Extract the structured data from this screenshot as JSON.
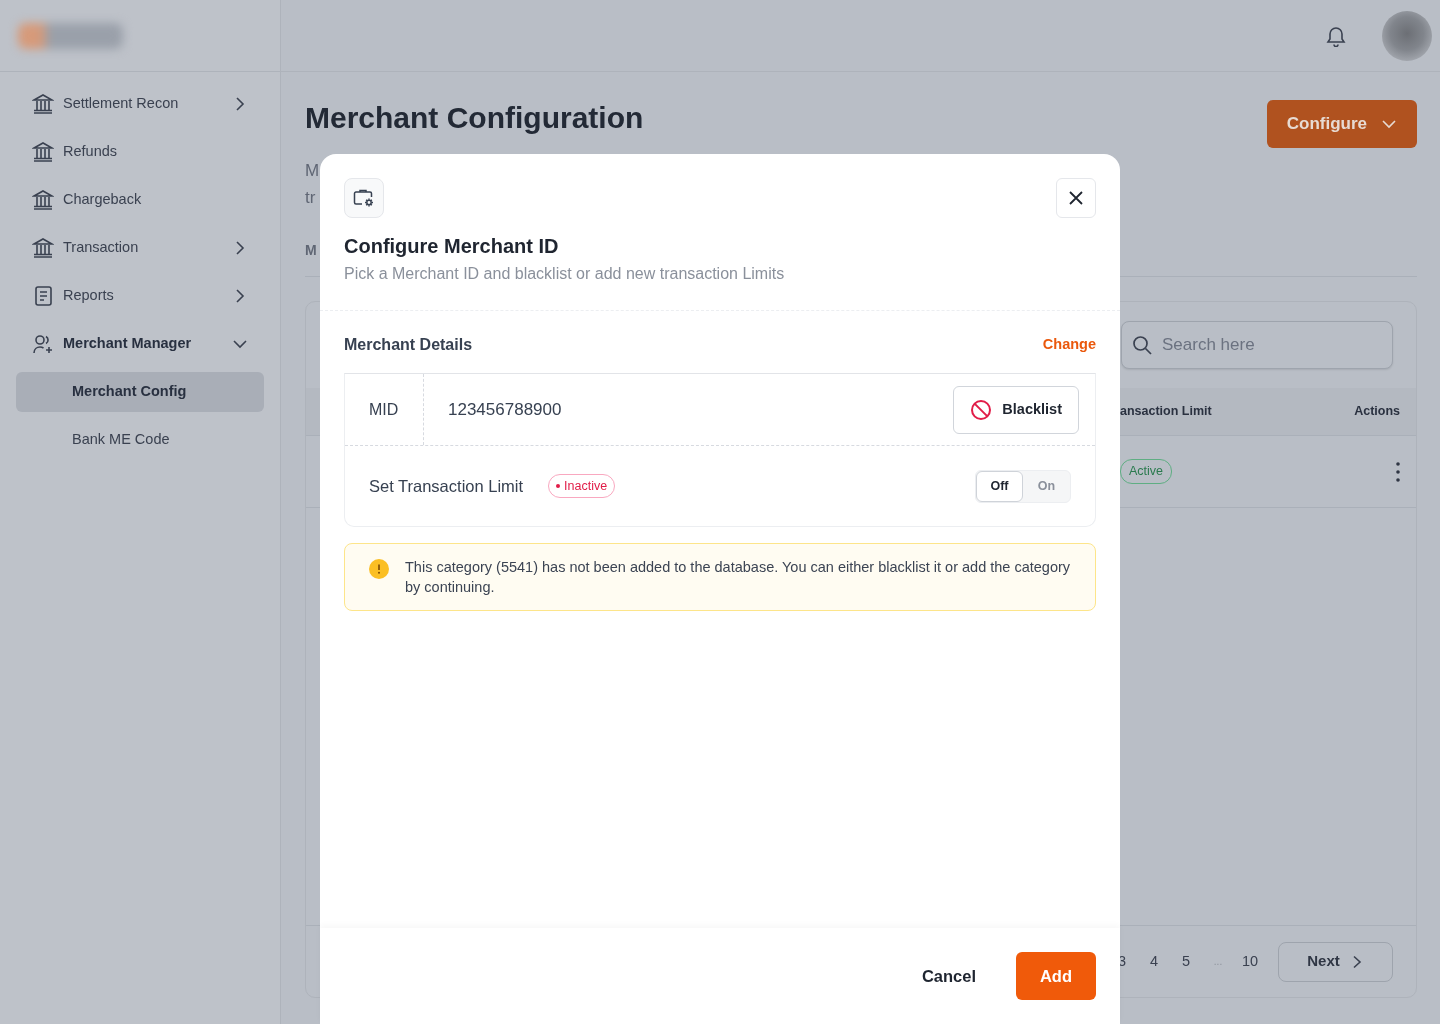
{
  "sidebar": {
    "items": [
      {
        "label": "Settlement Recon",
        "kind": "bank",
        "expanded": false
      },
      {
        "label": "Refunds",
        "kind": "bank"
      },
      {
        "label": "Chargeback",
        "kind": "bank"
      },
      {
        "label": "Transaction",
        "kind": "bank",
        "expanded": false
      },
      {
        "label": "Reports",
        "kind": "document",
        "expanded": false
      },
      {
        "label": "Merchant Manager",
        "kind": "users",
        "expanded": true,
        "children": [
          {
            "label": "Merchant Config",
            "selected": true
          },
          {
            "label": "Bank ME Code",
            "selected": false
          }
        ]
      }
    ]
  },
  "page": {
    "title": "Merchant Configuration",
    "description_lines": [
      "M",
      "tr"
    ],
    "tabs": [
      {
        "label": "M"
      }
    ],
    "configure_button": "Configure",
    "search": {
      "placeholder": "Search here"
    },
    "table": {
      "columns": [
        "ansaction Limit",
        "Actions"
      ],
      "rows": [
        {
          "status": "Active"
        }
      ]
    },
    "pagination": {
      "pages": [
        "3",
        "4",
        "5",
        "...",
        "10"
      ],
      "next": "Next"
    }
  },
  "modal": {
    "title": "Configure Merchant ID",
    "subtitle": "Pick a Merchant ID and blacklist or add new transaction Limits",
    "section_title": "Merchant Details",
    "change_link": "Change",
    "mid_label": "MID",
    "mid_value": "123456788900",
    "blacklist_button": "Blacklist",
    "limit_label": "Set Transaction Limit",
    "limit_status": {
      "text": "Inactive",
      "color": "#e11d48"
    },
    "toggle": [
      {
        "label": "Off",
        "selected": true
      },
      {
        "label": "On",
        "selected": false
      }
    ],
    "alert": "This category (5541) has not been added to the database. You can either blacklist it or add the category by continuing.",
    "buttons": {
      "cancel": "Cancel",
      "add": "Add"
    }
  }
}
